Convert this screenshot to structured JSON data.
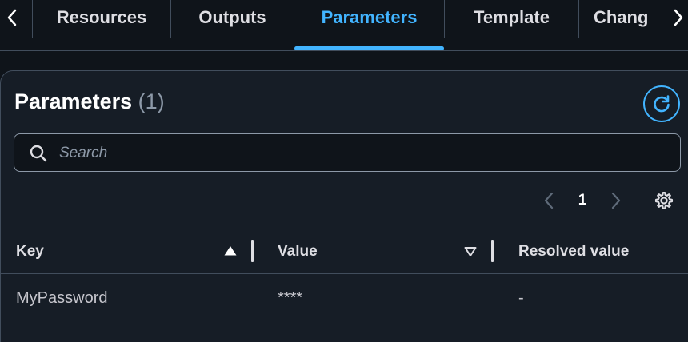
{
  "tabs": [
    {
      "label": "Resources",
      "active": false
    },
    {
      "label": "Outputs",
      "active": false
    },
    {
      "label": "Parameters",
      "active": true
    },
    {
      "label": "Template",
      "active": false
    },
    {
      "label": "Chang",
      "active": false
    }
  ],
  "panel": {
    "title": "Parameters",
    "count": "(1)"
  },
  "search": {
    "placeholder": "Search",
    "value": ""
  },
  "pagination": {
    "current_page": "1"
  },
  "table": {
    "columns": [
      {
        "label": "Key",
        "sort": "ascending"
      },
      {
        "label": "Value",
        "sort": "descending-inactive"
      },
      {
        "label": "Resolved value",
        "sort": "none"
      }
    ],
    "rows": [
      {
        "key": "MyPassword",
        "value": "****",
        "resolved_value": "-"
      }
    ]
  },
  "icons": {
    "tab_prev": "chevron-left-icon",
    "tab_next": "chevron-right-icon",
    "refresh": "refresh-icon",
    "search": "search-icon",
    "page_prev": "chevron-left-icon",
    "page_next": "chevron-right-icon",
    "settings": "gear-icon",
    "sort_asc": "caret-up-filled-icon",
    "sort_desc": "caret-down-outline-icon"
  },
  "colors": {
    "background": "#0f141a",
    "panel": "#161d26",
    "accent": "#42b4ff",
    "border": "#414d5c",
    "text": "#c6c6cd",
    "muted": "#8d99a8"
  }
}
